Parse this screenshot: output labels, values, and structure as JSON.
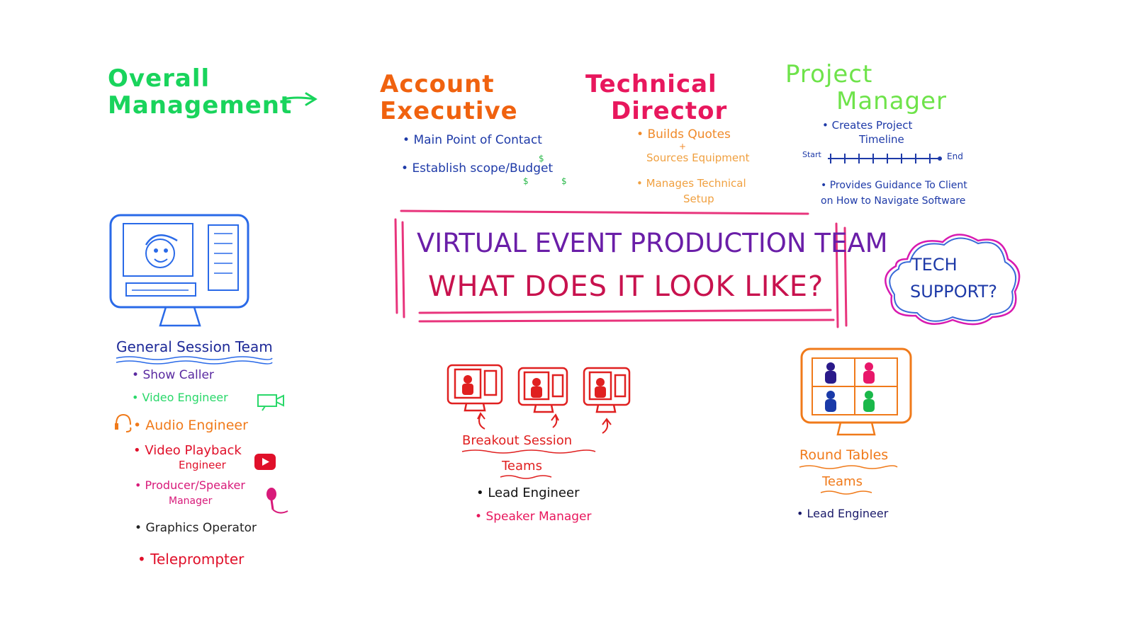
{
  "overall": {
    "line1": "Overall",
    "line2": "Management",
    "color": "#19d45c"
  },
  "account_exec": {
    "line1": "Account",
    "line2": "Executive",
    "bullets": [
      "Main Point of Contact",
      "Establish scope/Budget"
    ],
    "color": "#f0620f"
  },
  "tech_director": {
    "line1": "Technical",
    "line2": "Director",
    "bullets": [
      "Builds Quotes",
      "+",
      "Sources Equipment",
      "Manages Technical",
      "Setup"
    ],
    "color": "#e8175d"
  },
  "project_manager": {
    "line1": "Project",
    "line2": "Manager",
    "bullet1_line1": "Creates Project",
    "bullet1_line2": "Timeline",
    "timeline_start": "Start",
    "timeline_end": "End",
    "bullet2_line1": "Provides Guidance To Client",
    "bullet2_line2": "on How to Navigate Software",
    "color": "#6ee34a"
  },
  "title": {
    "line1": "VIRTUAL EVENT PRODUCTION TEAM",
    "line2": "WHAT DOES IT LOOK LIKE?"
  },
  "tech_support": {
    "line1": "TECH",
    "line2": "SUPPORT?"
  },
  "general_session": {
    "heading": "General Session Team",
    "roles": [
      {
        "label": "Show Caller",
        "color": "#5a2aa0"
      },
      {
        "label": "Video Engineer",
        "color": "#2ad86a"
      },
      {
        "label": "Audio Engineer",
        "color": "#f07a1a"
      },
      {
        "label": "Video Playback",
        "color": "#e0102a"
      },
      {
        "label": "Engineer",
        "color": "#e0102a"
      },
      {
        "label": "Producer/Speaker",
        "color": "#d81a7a"
      },
      {
        "label": "Manager",
        "color": "#d81a7a"
      },
      {
        "label": "Graphics Operator",
        "color": "#222222"
      },
      {
        "label": "Teleprompter",
        "color": "#e0102a"
      }
    ]
  },
  "breakout": {
    "heading_line1": "Breakout Session",
    "heading_line2": "Teams",
    "roles": [
      {
        "label": "Lead Engineer",
        "color": "#111111"
      },
      {
        "label": "Speaker Manager",
        "color": "#e8175d"
      }
    ]
  },
  "round_tables": {
    "heading_line1": "Round Tables",
    "heading_line2": "Teams",
    "roles": [
      {
        "label": "Lead Engineer",
        "color": "#1a1a6a"
      }
    ]
  },
  "icons": {
    "arrow": "right-arrow-icon",
    "monitor_blue": "monitor-icon",
    "camera": "video-camera-icon",
    "headphones": "headphones-icon",
    "play": "play-button-icon",
    "mic": "microphone-icon",
    "monitors_red": "monitor-icon",
    "monitor_orange": "monitor-icon",
    "cloud": "cloud-icon",
    "dollar": "dollar-sign-icon"
  }
}
